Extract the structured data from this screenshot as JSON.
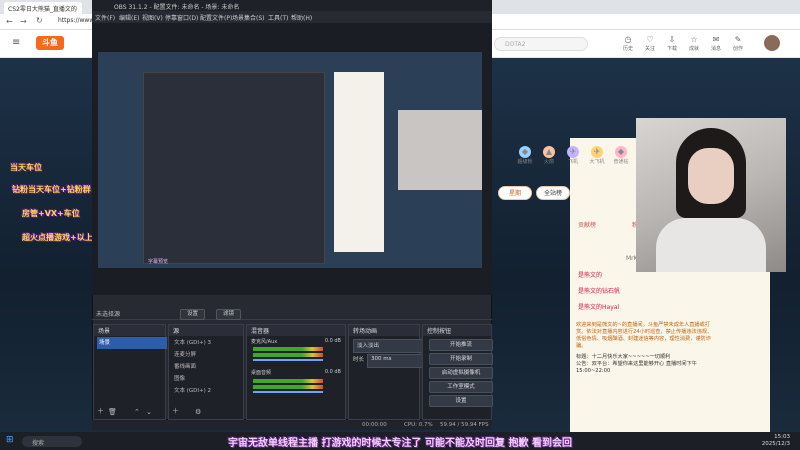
{
  "browser": {
    "tab_title": "CS2零日大熊猫_直播文的",
    "url": "https://www.dou",
    "site": {
      "logo": "斗鱼",
      "search_placeholder": "DOTA2",
      "header_icons": [
        "历史",
        "关注",
        "下载",
        "成就",
        "消息",
        "创作"
      ]
    }
  },
  "promos": [
    "当天车位",
    "钻粉当天车位+钻粉群",
    "房管+VX+车位",
    "超火点播游戏+以上"
  ],
  "right_panel": {
    "tabs": [
      "星期",
      "全站榜"
    ],
    "gifts": [
      "超级粉",
      "火箭",
      "飞机",
      "大飞机",
      "普通钻",
      "至尊钻",
      "粉丝"
    ],
    "rank_tabs": [
      "贡献榜",
      "粉丝团"
    ],
    "chat_users": [
      "是熊文的",
      "是熊文的钻石帆",
      "是熊文的Hayal"
    ],
    "user_label": "MrKasey:",
    "notice": "欢迎来到是熊文的~的直播间。斗鱼严禁未成年人直播或打赏。依法对直播内容进行24小时巡查，禁止传播违法违规、低俗色情、吸烟酗酒、封建迷信等内容，理性消费，谨防诈骗。",
    "notice2": "标题：十二月快乐大家~~~~~一切顺利",
    "notice3": "公告：双平台：希望你来这里能够开心 直播时间下午15:00~22:00"
  },
  "obs": {
    "title": "OBS 31.1.2 - 配置文件: 未命名 - 场景: 未命名",
    "menu": [
      "文件(F)",
      "编辑(E)",
      "视图(V)",
      "停靠窗口(D)",
      "配置文件(P)",
      "场景集合(S)",
      "工具(T)",
      "帮助(H)"
    ],
    "toolbar": {
      "source": "未选择源",
      "settings": "设置",
      "filters": "滤镜"
    },
    "panels": {
      "scenes": {
        "title": "场景",
        "items": [
          "场景"
        ]
      },
      "sources": {
        "title": "源",
        "items": [
          "文本 (GDI+) 3",
          "连麦分屏",
          "番线画面",
          "图像",
          "文本 (GDI+) 2"
        ]
      },
      "mixer": {
        "title": "混音器",
        "channels": [
          {
            "name": "麦克风/Aux",
            "db": "0.0 dB"
          },
          {
            "name": "桌面音频",
            "db": "0.0 dB"
          }
        ]
      },
      "transitions": {
        "title": "转场动画",
        "type": "淡入淡出",
        "duration_label": "时长",
        "duration": "300 ms"
      },
      "controls": {
        "title": "控制按钮",
        "buttons": [
          "开始推流",
          "开始录制",
          "启动虚拟摄像机",
          "工作室模式",
          "设置"
        ]
      }
    },
    "status": {
      "time": "00:00:00",
      "cpu": "CPU: 0.7%",
      "fps": "59.94 / 59.94 FPS"
    }
  },
  "subtitle": "宇宙无敌单线程主播 打游戏的时候太专注了 可能不能及时回复 抱歉 看到会回",
  "taskbar": {
    "search": "搜索",
    "time": "15:03",
    "date": "2025/12/3"
  }
}
